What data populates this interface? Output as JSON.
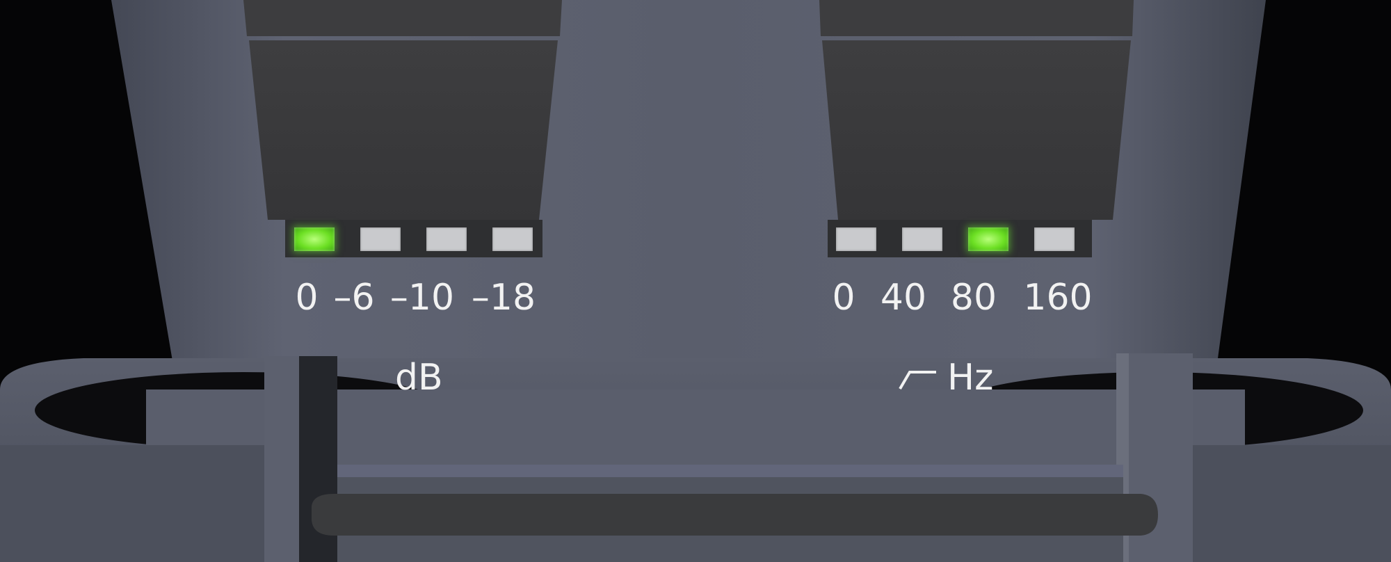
{
  "level_switch": {
    "scale": [
      "0",
      "–6",
      "–10",
      "–18"
    ],
    "unit": "dB",
    "active_index": 0
  },
  "highpass_switch": {
    "scale": [
      "0",
      "40",
      "80",
      "160"
    ],
    "unit": "Hz",
    "unit_icon": "high-pass-filter-icon",
    "active_index": 2
  },
  "colors": {
    "body": "#5d6170",
    "led_on": "#6de024",
    "led_off": "#c9cacd",
    "key": "#3b3b3d"
  }
}
